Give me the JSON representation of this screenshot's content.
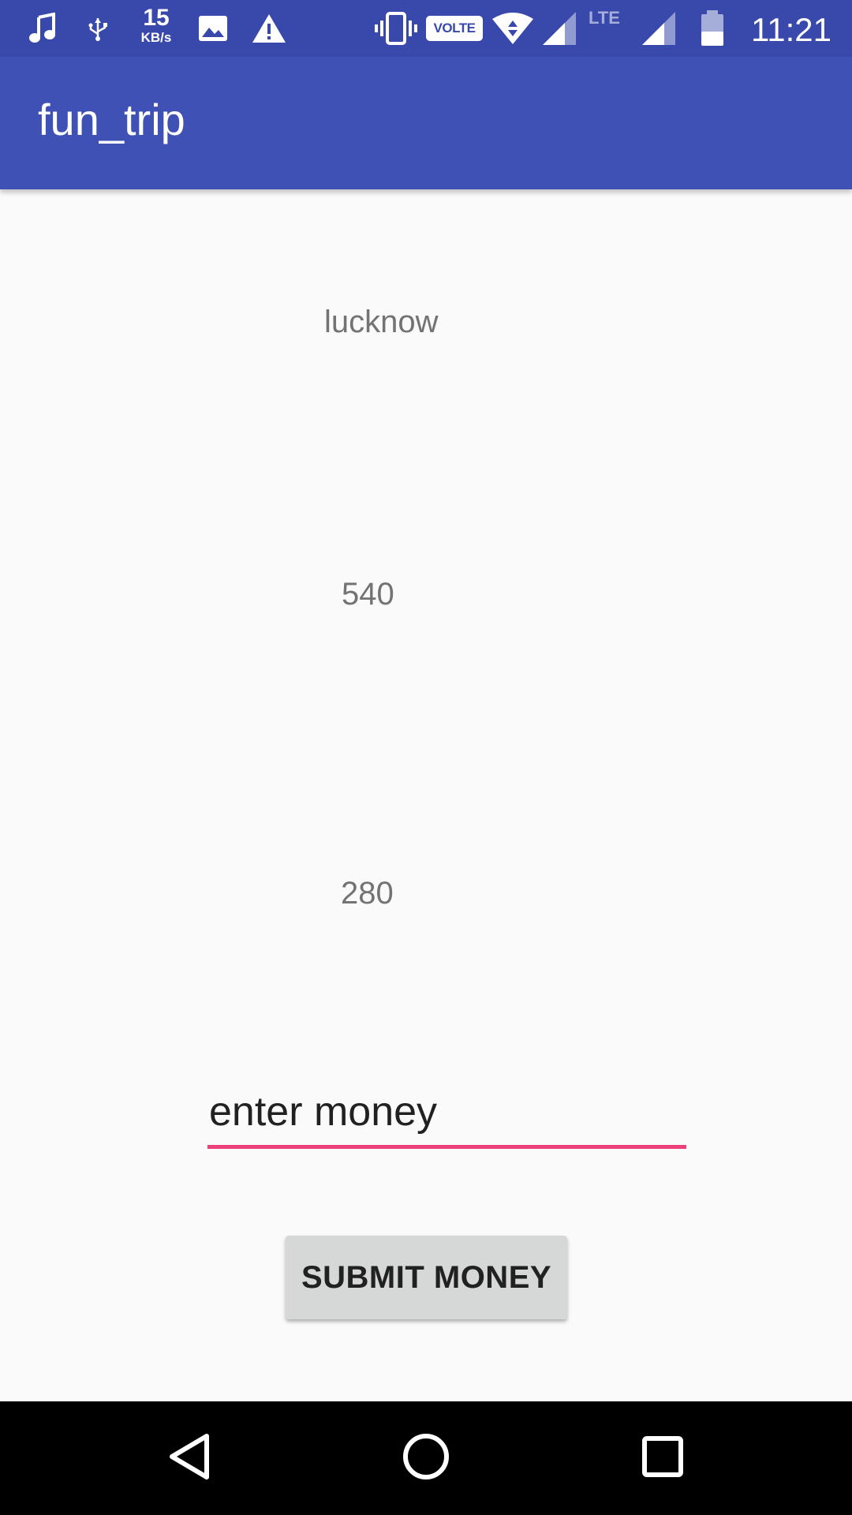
{
  "status_bar": {
    "icons": [
      "music-note-icon",
      "usb-debug-icon",
      "image-icon",
      "warning-icon",
      "vibrate-icon",
      "wifi-icon",
      "signal-icon",
      "battery-icon"
    ],
    "network_speed_value": "15",
    "network_speed_unit": "KB/s",
    "volte_label": "VOLTE",
    "lte_label": "LTE",
    "time": "11:21"
  },
  "app_bar": {
    "title": "fun_trip"
  },
  "content": {
    "city": "lucknow",
    "value_1": "540",
    "value_2": "280",
    "money_input": {
      "placeholder": "enter money",
      "value": ""
    },
    "submit_label": "SUBMIT MONEY"
  },
  "nav_bar": {
    "icons": [
      "back-icon",
      "home-icon",
      "recents-icon"
    ]
  },
  "colors": {
    "status_bar_bg": "#3949ab",
    "app_bar_bg": "#3f51b5",
    "accent": "#ec407a",
    "background": "#fafafa",
    "button_bg": "#d6d7d7",
    "nav_bar_bg": "#000000"
  }
}
